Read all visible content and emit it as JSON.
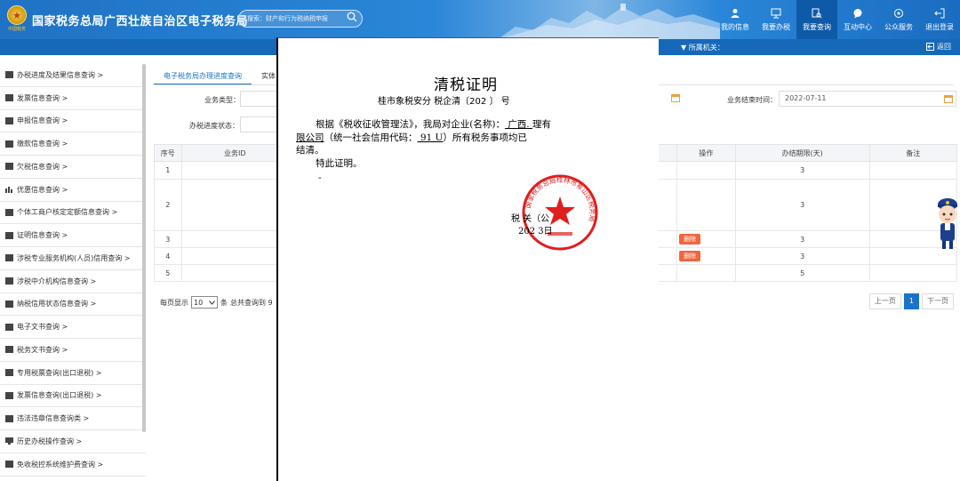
{
  "header": {
    "logo_text": "中国税务",
    "site_title": "国家税务总局广西壮族自治区电子税务局",
    "search_placeholder": "搜索：财产和行为税纳税申报",
    "nav": [
      {
        "label": "我的信息",
        "icon": "user-icon"
      },
      {
        "label": "我要办税",
        "icon": "monitor-icon"
      },
      {
        "label": "我要查询",
        "icon": "search-doc-icon",
        "active": true
      },
      {
        "label": "互动中心",
        "icon": "chat-icon"
      },
      {
        "label": "公众服务",
        "icon": "service-icon"
      },
      {
        "label": "退出登录",
        "icon": "logout-icon"
      }
    ]
  },
  "subbar": {
    "org_label": "▼  所属机关：",
    "back_label": "返回"
  },
  "sidebar": {
    "items": [
      {
        "label": "办税进度及结果信息查询 >"
      },
      {
        "label": "发票信息查询 >"
      },
      {
        "label": "申报信息查询 >"
      },
      {
        "label": "缴款信息查询 >"
      },
      {
        "label": "欠税信息查询 >"
      },
      {
        "label": "优惠信息查询 >"
      },
      {
        "label": "个体工商户核定定额信息查询 >"
      },
      {
        "label": "证明信息查询 >"
      },
      {
        "label": "涉税专业服务机构(人员)信用查询 >"
      },
      {
        "label": "涉税中介机构信息查询 >"
      },
      {
        "label": "纳税信用状态信息查询 >"
      },
      {
        "label": "电子文书查询 >"
      },
      {
        "label": "税务文书查询 >"
      },
      {
        "label": "专用税票查询(出口退税) >"
      },
      {
        "label": "发票信息查询(出口退税) >"
      },
      {
        "label": "违法违章信息查询类 >"
      },
      {
        "label": "历史办税操作查询 >"
      },
      {
        "label": "免收税控系统维护费查询 >"
      }
    ]
  },
  "main": {
    "tabs": [
      {
        "label": "电子税务局办理进度查询",
        "active": true
      },
      {
        "label": "实体"
      }
    ],
    "form": {
      "business_type_label": "业务类型：",
      "progress_status_label": "办税进度状态：",
      "end_time_label": "业务结束时间：",
      "end_time_value": "2022-07-11"
    },
    "table": {
      "columns": [
        "序号",
        "业务ID",
        "操作",
        "办结期限(天)",
        "备注"
      ],
      "rows": [
        {
          "no": "1",
          "action": "",
          "days": "3"
        },
        {
          "no": "2",
          "action": "",
          "days": "3"
        },
        {
          "no": "3",
          "action": "删除",
          "days": "3"
        },
        {
          "no": "4",
          "action": "删除",
          "days": "3"
        },
        {
          "no": "5",
          "action": "",
          "days": "5"
        }
      ]
    },
    "pager": {
      "per_page_label": "每页显示",
      "per_page_value": "10",
      "per_page_unit": "条",
      "total_label": "总共查询到 9",
      "prev": "上一页",
      "current": "1",
      "next": "下一页"
    }
  },
  "certificate": {
    "title": "清税证明",
    "number_line": "桂市象税安分 税企清〔202   〕          号",
    "para1_a": "根据《税收征收管理法》，我局对企业(名称)：",
    "para1_name": " 广西.                     ",
    "para1_name_end": "理有",
    "para1_b": "限公司",
    "para1_c": "（统一社会信用代码：",
    "para1_code": " 91                          U",
    "para1_d": "）所有税务事项均已",
    "para1_e": "结清。",
    "para2": "特此证明。",
    "dash": "-",
    "sign_line1": "税       关（公",
    "sign_line2": "202         3日",
    "seal_text": "国家税务总局桂林市象山区税务局"
  }
}
